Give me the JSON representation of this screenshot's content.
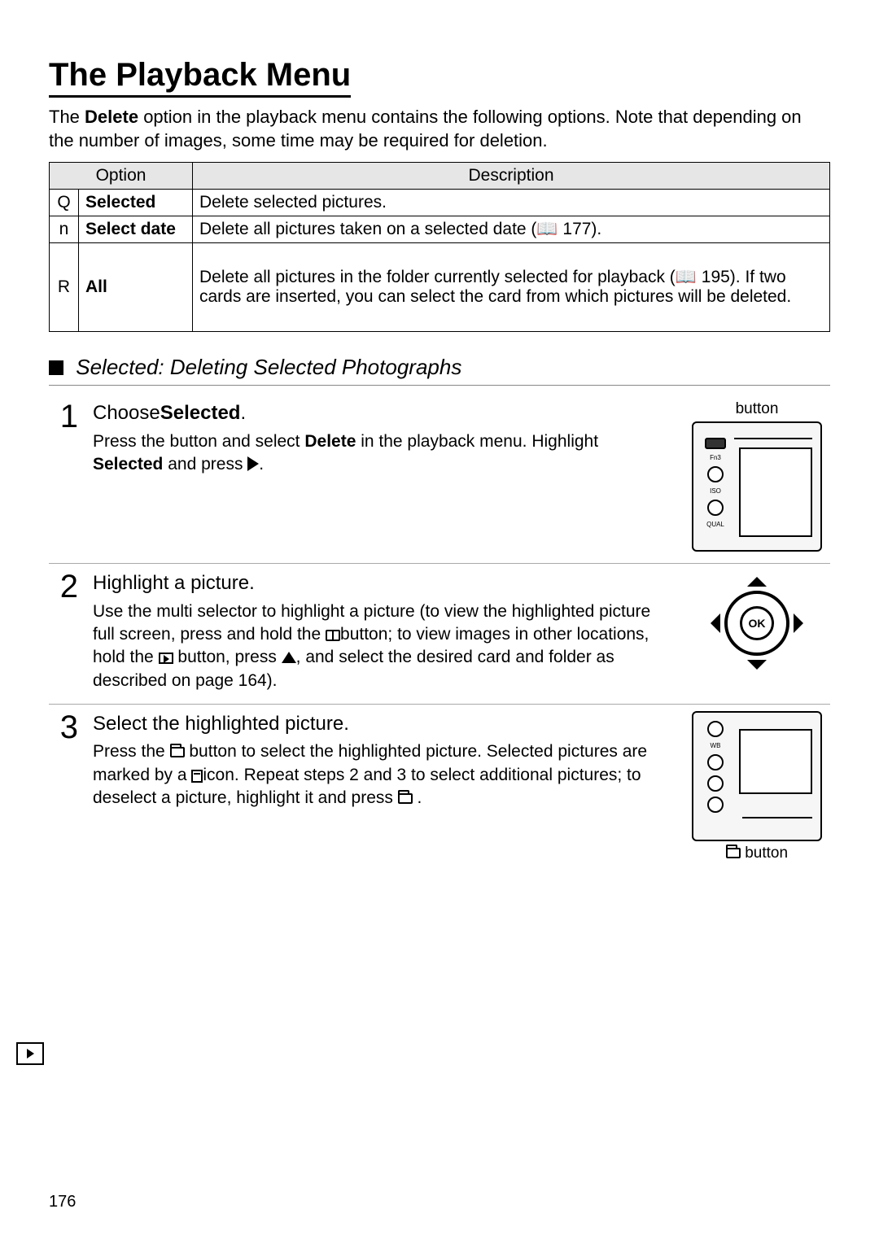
{
  "title": "The Playback Menu",
  "intro_pre": "The ",
  "intro_bold": "Delete",
  "intro_post": " option in the playback menu contains the following options.  Note that depending on the number of images, some time may be required for deletion.",
  "table": {
    "head_option": "Option",
    "head_desc": "Description",
    "rows": [
      {
        "icon": "Q",
        "option": "Selected",
        "desc": "Delete selected pictures."
      },
      {
        "icon": "n",
        "option": "Select date",
        "desc": "Delete all pictures taken on a selected date (📖 177)."
      },
      {
        "icon": "R",
        "option": "All",
        "desc": "Delete all pictures in the folder currently selected for playback (📖 195). If two cards are inserted, you can select the card from which pictures will be deleted."
      }
    ]
  },
  "section_title": "Selected: Deleting Selected Photographs",
  "steps": {
    "s1": {
      "num": "1",
      "head_pre": "Choose",
      "head_bold": "Selected",
      "head_post": ".",
      "body_a": "Press the ",
      "body_b": " button and select ",
      "body_bold": "Delete",
      "body_c": " in the playback menu.  Highlight ",
      "body_bold2": "Selected",
      "body_d": " and press ",
      "body_e": ".",
      "caption": "button"
    },
    "s2": {
      "num": "2",
      "head": "Highlight a picture.",
      "body_a": "Use the multi selector to highlight a picture (to view the highlighted picture full screen, press and hold the ",
      "body_b": "button; to view images in other locations, hold the ",
      "body_c": " button, press ",
      "body_d": ", and select the desired card and folder as described on page 164)."
    },
    "s3": {
      "num": "3",
      "head": "Select the highlighted picture.",
      "body_a": "Press the ",
      "body_b": " button to select the highlighted picture.  Selected pictures are marked by a ",
      "body_c": "icon.  Repeat steps 2 and 3 to select additional pictures; to deselect a picture, highlight it and press ",
      "body_d": " .",
      "caption": "button"
    }
  },
  "page_number": "176"
}
